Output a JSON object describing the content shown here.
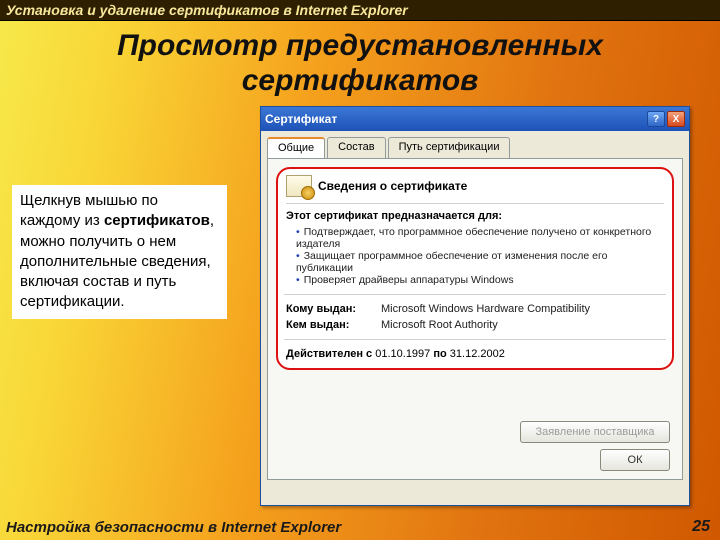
{
  "topbar": "Установка и удаление сертификатов в Internet Explorer",
  "title": "Просмотр предустановленных сертификатов",
  "body": {
    "pre": "Щелкнув мышью по каждому из ",
    "bold": "сертификатов",
    "post": ", можно получить о нем дополнительные сведения, включая состав и путь сертификации."
  },
  "dialog": {
    "title": "Сертификат",
    "help": "?",
    "close": "X",
    "tabs": {
      "general": "Общие",
      "details": "Состав",
      "path": "Путь сертификации"
    },
    "cert": {
      "header": "Сведения о сертификате",
      "purpose_title": "Этот сертификат предназначается для:",
      "purposes": [
        "Подтверждает, что программное обеспечение получено от конкретного издателя",
        "Защищает программное обеспечение от изменения после его публикации",
        "Проверяет драйверы аппаратуры Windows"
      ],
      "issued_to_k": "Кому выдан:",
      "issued_to_v": "Microsoft Windows Hardware Compatibility",
      "issued_by_k": "Кем выдан:",
      "issued_by_v": "Microsoft Root Authority",
      "valid_prefix": "Действителен с ",
      "valid_from": "01.10.1997",
      "valid_mid": " по ",
      "valid_to": "31.12.2002"
    },
    "buttons": {
      "issuer_stmt": "Заявление поставщика",
      "ok": "ОК"
    }
  },
  "footer": {
    "text": "Настройка безопасности в Internet Explorer",
    "page": "25"
  }
}
